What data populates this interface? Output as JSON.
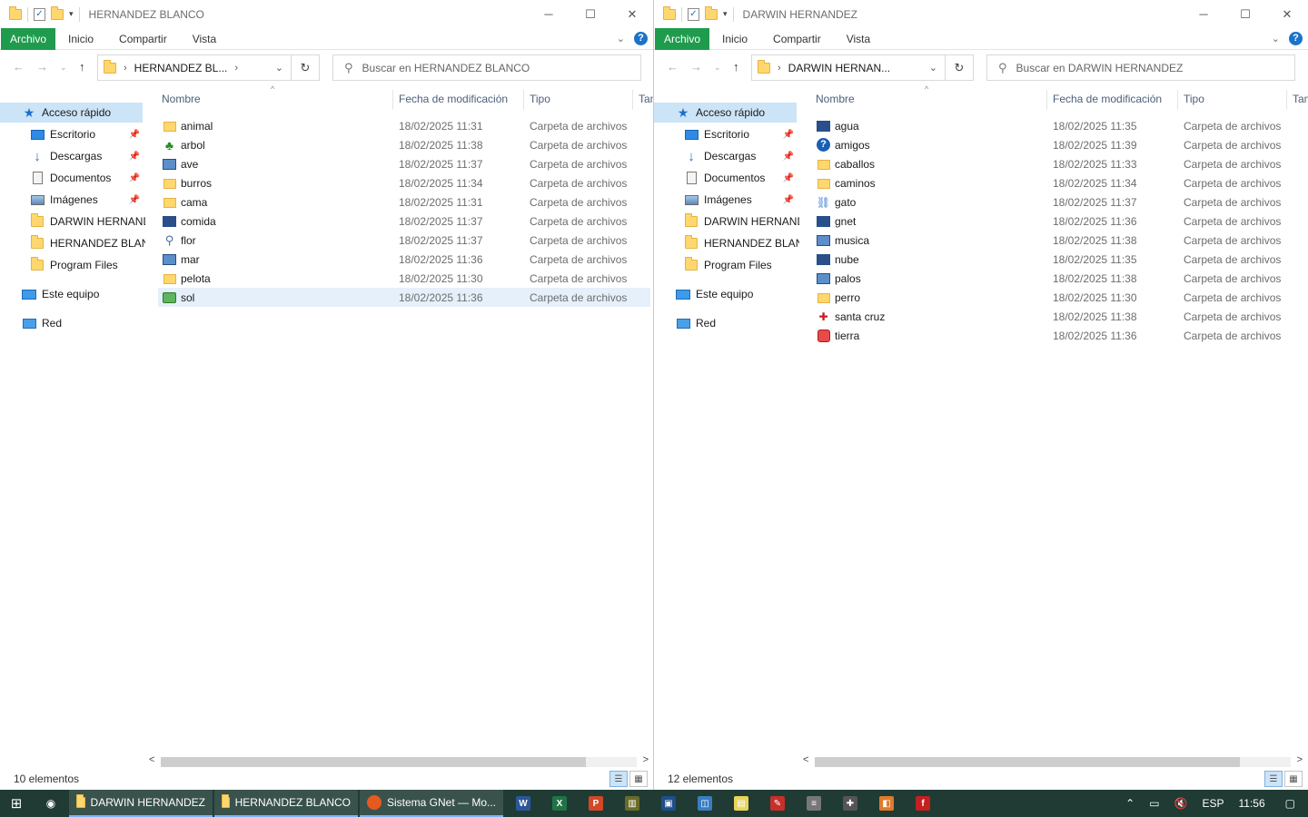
{
  "left": {
    "title": "HERNANDEZ BLANCO",
    "ribbon": {
      "file": "Archivo",
      "home": "Inicio",
      "share": "Compartir",
      "view": "Vista"
    },
    "address": "HERNANDEZ BL...",
    "search_placeholder": "Buscar en HERNANDEZ BLANCO",
    "nav": {
      "quick_access": "Acceso rápido",
      "desktop": "Escritorio",
      "downloads": "Descargas",
      "documents": "Documentos",
      "images": "Imágenes",
      "folder1": "DARWIN HERNANDEZ",
      "folder2": "HERNANDEZ BLANCO",
      "folder3": "Program Files",
      "this_pc": "Este equipo",
      "network": "Red"
    },
    "columns": {
      "name": "Nombre",
      "date": "Fecha de modificación",
      "type": "Tipo",
      "size": "Tamaño"
    },
    "files": [
      {
        "name": "animal",
        "date": "18/02/2025 11:31",
        "type": "Carpeta de archivos",
        "icon": "folder-icon"
      },
      {
        "name": "arbol",
        "date": "18/02/2025 11:38",
        "type": "Carpeta de archivos",
        "icon": "tree-icon"
      },
      {
        "name": "ave",
        "date": "18/02/2025 11:37",
        "type": "Carpeta de archivos",
        "icon": "screen-icon"
      },
      {
        "name": "burros",
        "date": "18/02/2025 11:34",
        "type": "Carpeta de archivos",
        "icon": "folder-icon"
      },
      {
        "name": "cama",
        "date": "18/02/2025 11:31",
        "type": "Carpeta de archivos",
        "icon": "folder-icon"
      },
      {
        "name": "comida",
        "date": "18/02/2025 11:37",
        "type": "Carpeta de archivos",
        "icon": "monitor-icon"
      },
      {
        "name": "flor",
        "date": "18/02/2025 11:37",
        "type": "Carpeta de archivos",
        "icon": "magnifier-icon"
      },
      {
        "name": "mar",
        "date": "18/02/2025 11:36",
        "type": "Carpeta de archivos",
        "icon": "screen-icon"
      },
      {
        "name": "pelota",
        "date": "18/02/2025 11:30",
        "type": "Carpeta de archivos",
        "icon": "folder-icon"
      },
      {
        "name": "sol",
        "date": "18/02/2025 11:36",
        "type": "Carpeta de archivos",
        "icon": "green-drive-icon"
      }
    ],
    "status": "10 elementos"
  },
  "right": {
    "title": "DARWIN HERNANDEZ",
    "ribbon": {
      "file": "Archivo",
      "home": "Inicio",
      "share": "Compartir",
      "view": "Vista"
    },
    "address": "DARWIN HERNAN...",
    "search_placeholder": "Buscar en DARWIN HERNANDEZ",
    "nav": {
      "quick_access": "Acceso rápido",
      "desktop": "Escritorio",
      "downloads": "Descargas",
      "documents": "Documentos",
      "images": "Imágenes",
      "folder1": "DARWIN HERNANDEZ",
      "folder2": "HERNANDEZ BLANCO",
      "folder3": "Program Files",
      "this_pc": "Este equipo",
      "network": "Red"
    },
    "columns": {
      "name": "Nombre",
      "date": "Fecha de modificación",
      "type": "Tipo",
      "size": "Tamaño"
    },
    "files": [
      {
        "name": "agua",
        "date": "18/02/2025 11:35",
        "type": "Carpeta de archivos",
        "icon": "monitor-icon"
      },
      {
        "name": "amigos",
        "date": "18/02/2025 11:39",
        "type": "Carpeta de archivos",
        "icon": "question-icon"
      },
      {
        "name": "caballos",
        "date": "18/02/2025 11:33",
        "type": "Carpeta de archivos",
        "icon": "folder-icon"
      },
      {
        "name": "caminos",
        "date": "18/02/2025 11:34",
        "type": "Carpeta de archivos",
        "icon": "folder-icon"
      },
      {
        "name": "gato",
        "date": "18/02/2025 11:37",
        "type": "Carpeta de archivos",
        "icon": "network-icon"
      },
      {
        "name": "gnet",
        "date": "18/02/2025 11:36",
        "type": "Carpeta de archivos",
        "icon": "monitor-icon"
      },
      {
        "name": "musica",
        "date": "18/02/2025 11:38",
        "type": "Carpeta de archivos",
        "icon": "screen-icon"
      },
      {
        "name": "nube",
        "date": "18/02/2025 11:35",
        "type": "Carpeta de archivos",
        "icon": "monitor-icon"
      },
      {
        "name": "palos",
        "date": "18/02/2025 11:38",
        "type": "Carpeta de archivos",
        "icon": "screen-icon"
      },
      {
        "name": "perro",
        "date": "18/02/2025 11:30",
        "type": "Carpeta de archivos",
        "icon": "folder-icon"
      },
      {
        "name": "santa cruz",
        "date": "18/02/2025 11:38",
        "type": "Carpeta de archivos",
        "icon": "cross-icon"
      },
      {
        "name": "tierra",
        "date": "18/02/2025 11:36",
        "type": "Carpeta de archivos",
        "icon": "red-icon"
      }
    ],
    "status": "12 elementos"
  },
  "taskbar": {
    "app1": "DARWIN HERNANDEZ",
    "app2": "HERNANDEZ BLANCO",
    "app3": "Sistema GNet — Mo...",
    "lang": "ESP",
    "time": "11:56"
  }
}
